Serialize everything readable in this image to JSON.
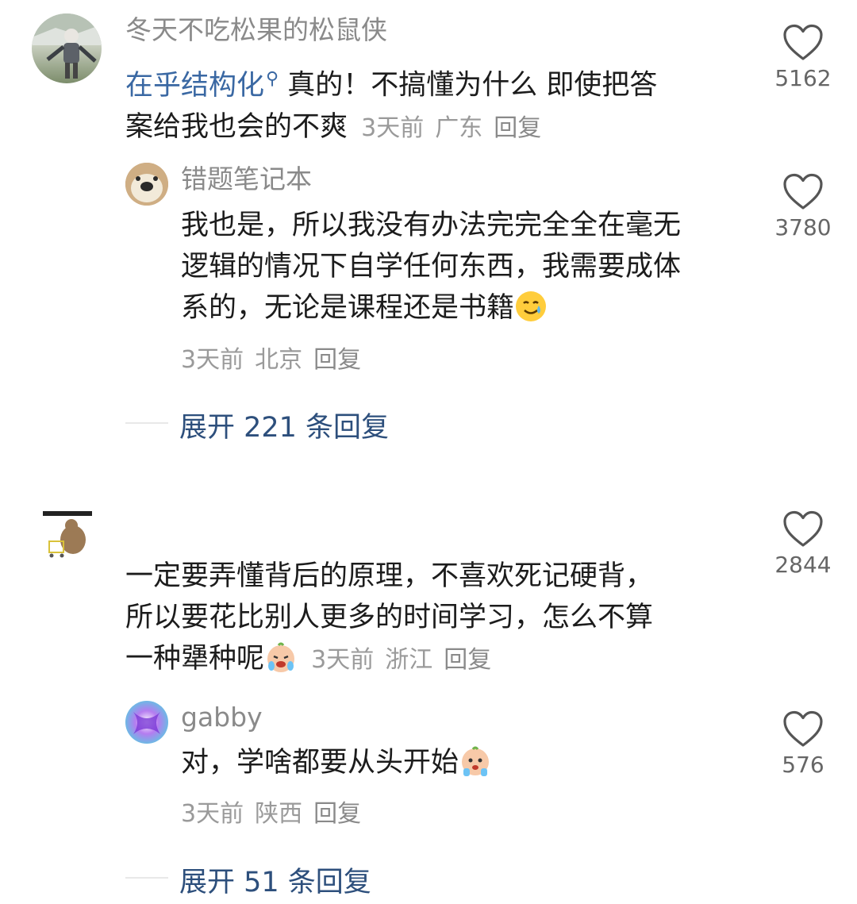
{
  "comments": [
    {
      "username": "冬天不吃松果的松鼠侠",
      "link_text": "在乎结构化",
      "text_line1": "真的！不搞懂为什么 即使把答",
      "text_line2": "案给我也会的不爽",
      "time": "3天前",
      "location": "广东",
      "reply_label": "回复",
      "likes": "5162",
      "replies": [
        {
          "username": "错题笔记本",
          "text_line1": "我也是，所以我没有办法完完全全在毫无",
          "text_line2": "逻辑的情况下自学任何东西，我需要成体",
          "text_line3": "系的，无论是课程还是书籍",
          "emoji": "smiling-tear-emoji",
          "time": "3天前",
          "location": "北京",
          "reply_label": "回复",
          "likes": "3780"
        }
      ],
      "expand_label": "展开 221 条回复"
    },
    {
      "username": "",
      "text_line1": "一定要弄懂背后的原理，不喜欢死记硬背，",
      "text_line2": "所以要花比别人更多的时间学习，怎么不算",
      "text_line3": "一种犟种呢",
      "emoji": "crying-baby-emoji",
      "time": "3天前",
      "location": "浙江",
      "reply_label": "回复",
      "likes": "2844",
      "replies": [
        {
          "username": "gabby",
          "text_line1": "对，学啥都要从头开始",
          "emoji": "shocked-baby-emoji",
          "time": "3天前",
          "location": "陕西",
          "reply_label": "回复",
          "likes": "576"
        }
      ],
      "expand_label": "展开 51 条回复"
    }
  ],
  "colors": {
    "link": "#3a68a3",
    "expand": "#2d4f7c",
    "meta": "#9a9a9a"
  }
}
